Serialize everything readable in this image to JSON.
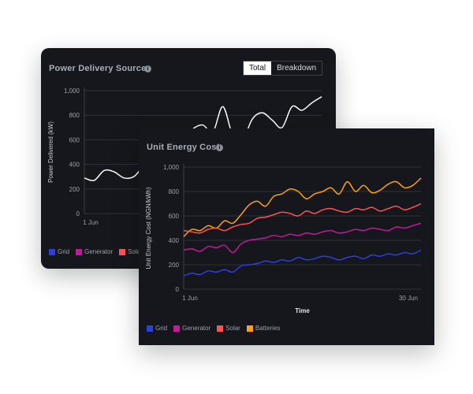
{
  "back_card": {
    "title": "Power Delivery Sources",
    "toggle": {
      "total_label": "Total",
      "breakdown_label": "Breakdown",
      "active": "Total"
    },
    "legend": [
      {
        "label": "Grid",
        "color": "#2d3fe0"
      },
      {
        "label": "Generator",
        "color": "#c21a9b"
      },
      {
        "label": "Solar",
        "color": "#ff5252"
      }
    ]
  },
  "front_card": {
    "title": "Unit Energy Cost",
    "legend": [
      {
        "label": "Grid",
        "color": "#2d3fe0"
      },
      {
        "label": "Generator",
        "color": "#c21a9b"
      },
      {
        "label": "Solar",
        "color": "#ff5252"
      },
      {
        "label": "Batteries",
        "color": "#ffa115"
      }
    ]
  },
  "chart_data": [
    {
      "type": "line",
      "ylabel": "Power Delivered (kW)",
      "ylim": [
        0,
        1000
      ],
      "yticks": [
        "0",
        "200",
        "400",
        "600",
        "800",
        "1,000"
      ],
      "x_tick_labels": [
        "1 Jun"
      ],
      "grid": true,
      "series": [
        {
          "name": "Total",
          "color": "#ffffff",
          "values": [
            290,
            270,
            350,
            340,
            290,
            300,
            380,
            360,
            310,
            320,
            600,
            690,
            720,
            660,
            870,
            640,
            600,
            770,
            820,
            760,
            700,
            870,
            840,
            900,
            950
          ]
        }
      ]
    },
    {
      "type": "line",
      "title": "Unit Energy Cost",
      "xlabel": "Time",
      "ylabel": "Unit Energy Cost (NGN/kWh)",
      "ylim": [
        0,
        1000
      ],
      "yticks": [
        "0",
        "200",
        "400",
        "600",
        "800",
        "1,000"
      ],
      "x_tick_labels": [
        "1 Jun",
        "30 Jun"
      ],
      "grid": true,
      "legend_position": "bottom-left",
      "series": [
        {
          "name": "Batteries",
          "color": "#ffa115",
          "values": [
            430,
            490,
            480,
            520,
            500,
            560,
            540,
            610,
            690,
            720,
            680,
            760,
            780,
            820,
            800,
            740,
            780,
            800,
            830,
            780,
            880,
            800,
            850,
            790,
            810,
            860,
            880,
            830,
            850,
            910
          ]
        },
        {
          "name": "Solar",
          "color": "#ff5252",
          "values": [
            480,
            470,
            460,
            490,
            500,
            480,
            510,
            530,
            540,
            580,
            590,
            610,
            630,
            620,
            600,
            640,
            620,
            650,
            660,
            640,
            630,
            660,
            650,
            670,
            640,
            660,
            680,
            650,
            670,
            700
          ]
        },
        {
          "name": "Generator",
          "color": "#c21a9b",
          "values": [
            320,
            330,
            310,
            350,
            340,
            360,
            300,
            370,
            400,
            410,
            420,
            440,
            430,
            450,
            440,
            460,
            450,
            470,
            480,
            460,
            470,
            490,
            480,
            500,
            490,
            480,
            510,
            500,
            520,
            540
          ]
        },
        {
          "name": "Grid",
          "color": "#2d3fe0",
          "values": [
            110,
            130,
            120,
            150,
            140,
            160,
            140,
            190,
            200,
            210,
            230,
            220,
            240,
            230,
            260,
            240,
            250,
            270,
            260,
            240,
            260,
            270,
            250,
            280,
            270,
            290,
            280,
            300,
            290,
            320
          ]
        }
      ]
    }
  ]
}
